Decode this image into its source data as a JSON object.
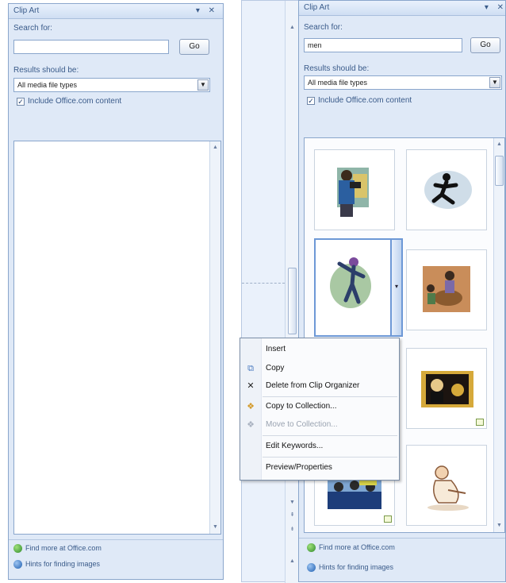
{
  "left_pane": {
    "title": "Clip Art",
    "title_icons": "▾ ✕",
    "search_label": "Search for:",
    "search_value": "",
    "go_label": "Go",
    "results_label": "Results should be:",
    "media_type": "All media file types",
    "include_label": "Include Office.com content",
    "include_checked": "✓",
    "link_more": "Find more at Office.com",
    "link_hints": "Hints for finding images"
  },
  "right_pane": {
    "title": "Clip Art",
    "title_icons": "▾ ✕",
    "search_label": "Search for:",
    "search_value": "men",
    "go_label": "Go",
    "results_label": "Results should be:",
    "media_type": "All media file types",
    "include_label": "Include Office.com content",
    "include_checked": "✓",
    "link_more": "Find more at Office.com",
    "link_hints": "Hints for finding images"
  },
  "context_menu": {
    "items": [
      {
        "label": "Insert",
        "icon": "none"
      },
      {
        "label": "Copy",
        "icon": "copy-icon"
      },
      {
        "label": "Delete from Clip Organizer",
        "icon": "delete-x-icon"
      },
      {
        "label": "Copy to Collection...",
        "icon": "collection-icon"
      },
      {
        "label": "Move to Collection...",
        "icon": "move-collection-icon",
        "disabled": true
      },
      {
        "label": "Edit Keywords...",
        "icon": "none"
      },
      {
        "label": "Preview/Properties",
        "icon": "none"
      }
    ]
  },
  "colors": {
    "pane_bg": "#dfe9f7",
    "pane_border": "#8aa6cc",
    "selection_border": "#6d98d6",
    "text": "#3a5b8a"
  }
}
